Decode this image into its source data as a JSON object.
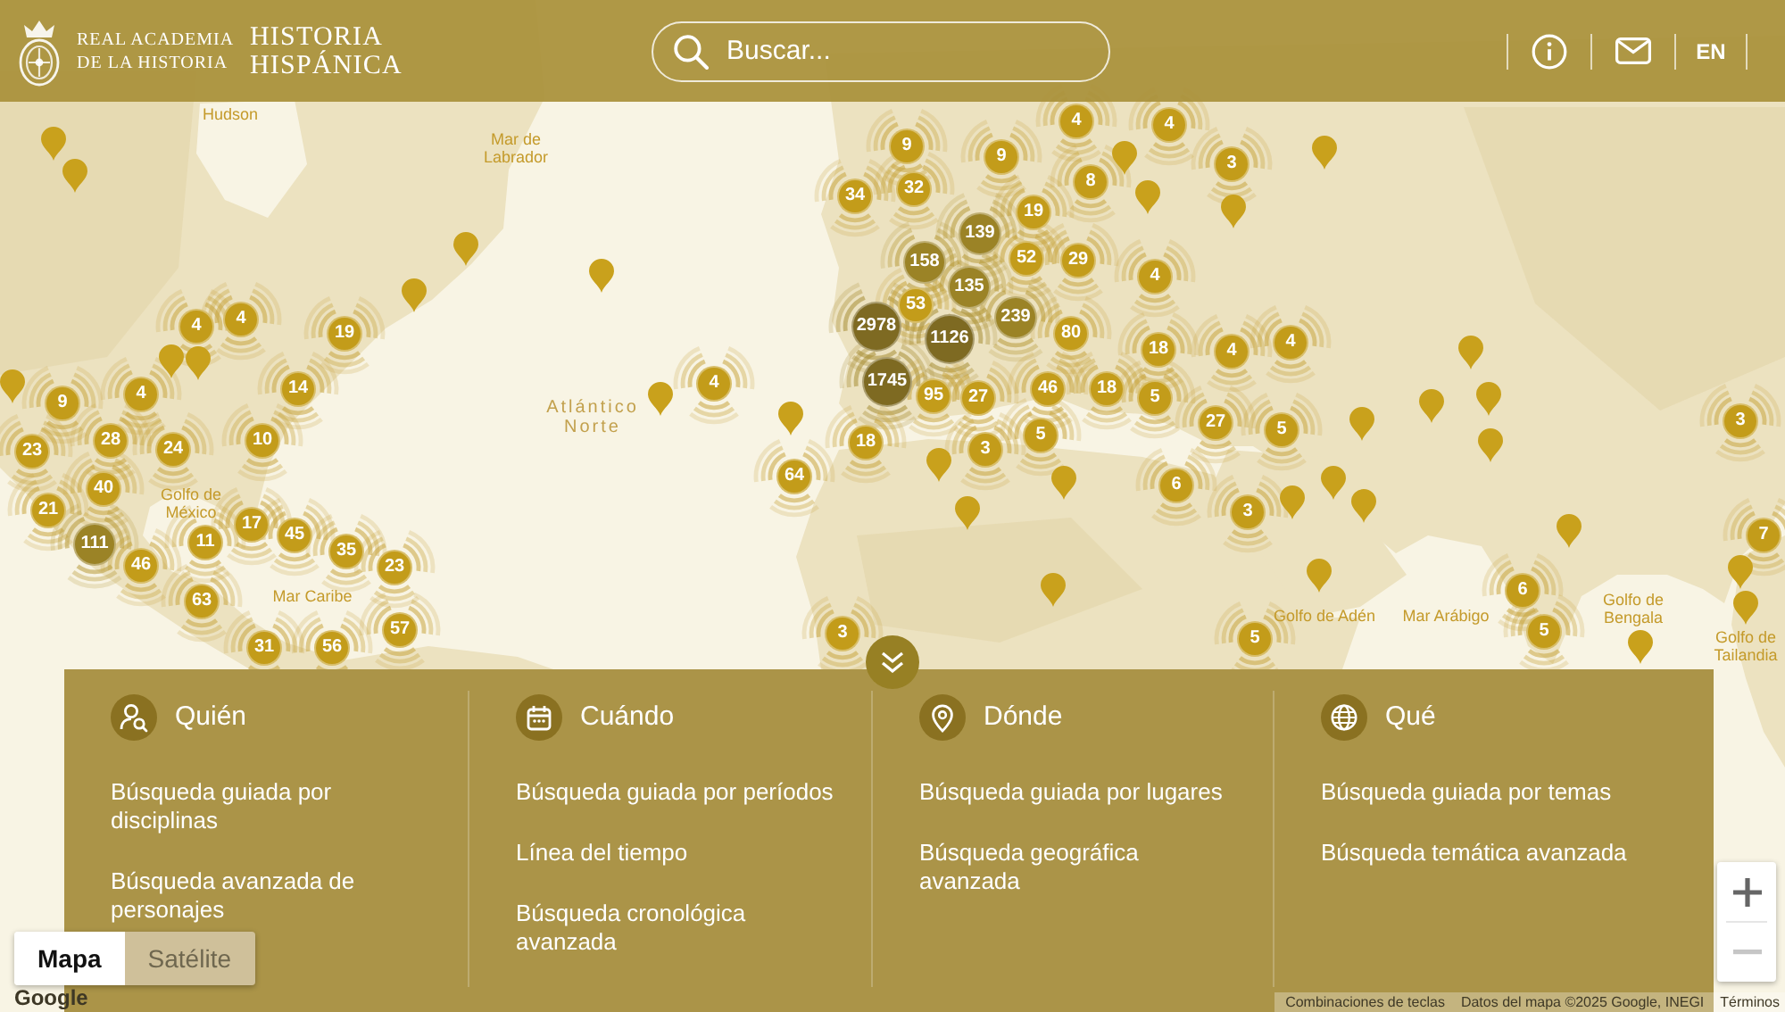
{
  "header": {
    "institution": [
      "REAL ACADEMIA",
      "DE LA HISTORIA"
    ],
    "site_title": [
      "HISTORIA",
      "HISPÁNICA"
    ],
    "search": {
      "placeholder": "Buscar..."
    },
    "language": "EN"
  },
  "map": {
    "labels": [
      {
        "text": "Hudson",
        "kind": "sea"
      },
      {
        "text": "Mar de Labrador",
        "kind": "sea"
      },
      {
        "text": "Atlántico Norte",
        "kind": "ocean"
      },
      {
        "text": "Golfo de México",
        "kind": "sea"
      },
      {
        "text": "Mar Caribe",
        "kind": "sea"
      },
      {
        "text": "Golfo de Adén",
        "kind": "sea"
      },
      {
        "text": "Mar Arábigo",
        "kind": "sea"
      },
      {
        "text": "Golfo de Bengala",
        "kind": "sea"
      },
      {
        "text": "Golfo de Tailandia",
        "kind": "sea"
      }
    ],
    "clusters": [
      {
        "count": "4",
        "kind": "small"
      },
      {
        "count": "4",
        "kind": "small"
      },
      {
        "count": "9",
        "kind": "small"
      },
      {
        "count": "9",
        "kind": "small"
      },
      {
        "count": "3",
        "kind": "small"
      },
      {
        "count": "34",
        "kind": "small"
      },
      {
        "count": "32",
        "kind": "small"
      },
      {
        "count": "8",
        "kind": "small"
      },
      {
        "count": "19",
        "kind": "small"
      },
      {
        "count": "139",
        "kind": "medium"
      },
      {
        "count": "158",
        "kind": "medium"
      },
      {
        "count": "52",
        "kind": "small"
      },
      {
        "count": "29",
        "kind": "small"
      },
      {
        "count": "135",
        "kind": "medium"
      },
      {
        "count": "4",
        "kind": "small"
      },
      {
        "count": "4",
        "kind": "small"
      },
      {
        "count": "4",
        "kind": "small"
      },
      {
        "count": "19",
        "kind": "small"
      },
      {
        "count": "2978",
        "kind": "large"
      },
      {
        "count": "53",
        "kind": "small"
      },
      {
        "count": "1126",
        "kind": "large"
      },
      {
        "count": "239",
        "kind": "medium"
      },
      {
        "count": "80",
        "kind": "small"
      },
      {
        "count": "18",
        "kind": "small"
      },
      {
        "count": "4",
        "kind": "small"
      },
      {
        "count": "4",
        "kind": "small"
      },
      {
        "count": "9",
        "kind": "small"
      },
      {
        "count": "4",
        "kind": "small"
      },
      {
        "count": "14",
        "kind": "small"
      },
      {
        "count": "4",
        "kind": "small"
      },
      {
        "count": "1745",
        "kind": "large"
      },
      {
        "count": "95",
        "kind": "small"
      },
      {
        "count": "27",
        "kind": "small"
      },
      {
        "count": "46",
        "kind": "small"
      },
      {
        "count": "18",
        "kind": "small"
      },
      {
        "count": "5",
        "kind": "small"
      },
      {
        "count": "5",
        "kind": "small"
      },
      {
        "count": "27",
        "kind": "small"
      },
      {
        "count": "5",
        "kind": "small"
      },
      {
        "count": "3",
        "kind": "small"
      },
      {
        "count": "23",
        "kind": "small"
      },
      {
        "count": "28",
        "kind": "small"
      },
      {
        "count": "24",
        "kind": "small"
      },
      {
        "count": "10",
        "kind": "small"
      },
      {
        "count": "18",
        "kind": "small"
      },
      {
        "count": "3",
        "kind": "small"
      },
      {
        "count": "40",
        "kind": "small"
      },
      {
        "count": "64",
        "kind": "small"
      },
      {
        "count": "6",
        "kind": "small"
      },
      {
        "count": "21",
        "kind": "small"
      },
      {
        "count": "3",
        "kind": "small"
      },
      {
        "count": "111",
        "kind": "medium"
      },
      {
        "count": "11",
        "kind": "small"
      },
      {
        "count": "17",
        "kind": "small"
      },
      {
        "count": "45",
        "kind": "small"
      },
      {
        "count": "35",
        "kind": "small"
      },
      {
        "count": "7",
        "kind": "small"
      },
      {
        "count": "46",
        "kind": "small"
      },
      {
        "count": "23",
        "kind": "small"
      },
      {
        "count": "63",
        "kind": "small"
      },
      {
        "count": "6",
        "kind": "small"
      },
      {
        "count": "31",
        "kind": "small"
      },
      {
        "count": "56",
        "kind": "small"
      },
      {
        "count": "57",
        "kind": "small"
      },
      {
        "count": "3",
        "kind": "small"
      },
      {
        "count": "5",
        "kind": "small"
      },
      {
        "count": "5",
        "kind": "small"
      }
    ],
    "map_type": [
      {
        "label": "Mapa",
        "selected": true
      },
      {
        "label": "Satélite",
        "selected": false
      }
    ],
    "zoom": {
      "zoom_out_disabled": true
    },
    "logo": "Google",
    "attribution": [
      "Combinaciones de teclas",
      "Datos del mapa ©2025 Google, INEGI",
      "Términos"
    ]
  },
  "search_panel": {
    "expanded": true,
    "columns": [
      {
        "heading": "Quién",
        "kind": "who",
        "links": [
          "Búsqueda guiada por disciplinas",
          "Búsqueda avanzada de personajes"
        ]
      },
      {
        "heading": "Cuándo",
        "kind": "when",
        "links": [
          "Búsqueda guiada por períodos",
          "Línea del tiempo",
          "Búsqueda cronológica avanzada"
        ]
      },
      {
        "heading": "Dónde",
        "kind": "where",
        "links": [
          "Búsqueda guiada por lugares",
          "Búsqueda geográfica avanzada"
        ]
      },
      {
        "heading": "Qué",
        "kind": "what",
        "links": [
          "Búsqueda guiada por temas",
          "Búsqueda temática avanzada"
        ]
      }
    ]
  }
}
